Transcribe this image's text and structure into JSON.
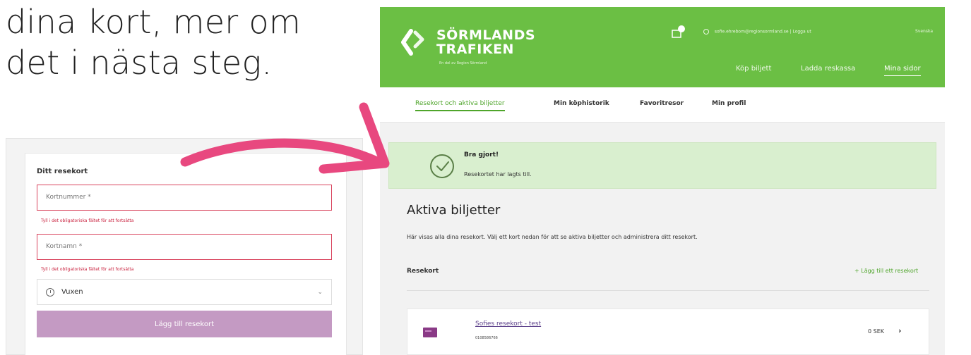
{
  "intro": {
    "line1": "dina kort, mer om",
    "line2": "det i nästa steg."
  },
  "form": {
    "title": "Ditt resekort",
    "card_number_placeholder": "Kortnummer *",
    "card_number_error": "Tyll i det obligatoriska fältet för att fortsätta",
    "card_name_placeholder": "Kortnamn *",
    "card_name_error": "Tyll i det obligatoriska fältet för att fortsätta",
    "traveller_type": "Vuxen",
    "submit_label": "Lägg till resekort"
  },
  "header": {
    "logo_line1": "SÖRMLANDS",
    "logo_line2": "TRAFIKEN",
    "logo_sub": "En del av Region Sörmland",
    "user_email": "sofie.ehrebom@regionsormland.se",
    "logout": "Logga ut",
    "language": "Svenska",
    "nav": [
      "Köp biljett",
      "Ladda reskassa",
      "Mina sidor"
    ]
  },
  "tabs": [
    "Resekort och aktiva biljetter",
    "Min köphistorik",
    "Favoritresor",
    "Min profil"
  ],
  "success": {
    "title": "Bra gjort!",
    "message": "Resekortet har lagts till."
  },
  "active": {
    "title": "Aktiva biljetter",
    "description": "Här visas alla dina resekort. Välj ett kort nedan för att se aktiva biljetter och administrera ditt resekort.",
    "resekort_label": "Resekort",
    "add_card_link": "+ Lägg till ett resekort"
  },
  "card": {
    "name": "Sofies resekort - test",
    "number": "0108586766",
    "balance": "0 SEK"
  },
  "colors": {
    "brand_green": "#6bbf44",
    "arrow_pink": "#e8487f",
    "success_bg": "#d9efcf",
    "button_purple": "#c49ac3"
  }
}
